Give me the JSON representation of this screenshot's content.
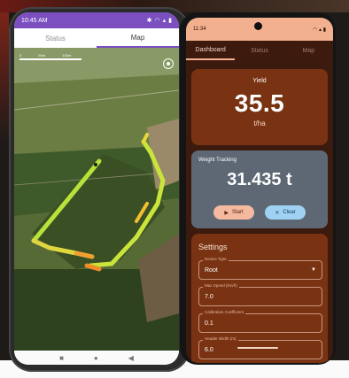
{
  "left_phone": {
    "status_bar": {
      "time": "10:45 AM"
    },
    "tabs": [
      {
        "label": "Status"
      },
      {
        "label": "Map"
      }
    ],
    "active_tab": "Map",
    "map": {
      "scale_labels": [
        "0",
        "50m",
        "100m"
      ]
    }
  },
  "right_phone": {
    "status_bar": {
      "time": "11:34"
    },
    "tabs": [
      {
        "label": "Dashboard"
      },
      {
        "label": "Status"
      },
      {
        "label": "Map"
      }
    ],
    "active_tab": "Dashboard",
    "yield": {
      "label": "Yield",
      "value": "35.5",
      "unit": "t/ha"
    },
    "weight": {
      "label": "Weight Tracking",
      "value": "31.435 t",
      "start_label": "Start",
      "clear_label": "Clear"
    },
    "settings": {
      "title": "Settings",
      "fields": [
        {
          "label": "Device Type",
          "value": "Root"
        },
        {
          "label": "Max Speed (km/h)",
          "value": "7.0"
        },
        {
          "label": "Calibration Coefficient",
          "value": "0.1"
        },
        {
          "label": "Header Width (m)",
          "value": "6.0"
        }
      ]
    },
    "colors": {
      "accent": "#f3b08f",
      "card": "#7a3312",
      "weight_card": "#5d6874",
      "background": "#3d1a0e"
    }
  }
}
